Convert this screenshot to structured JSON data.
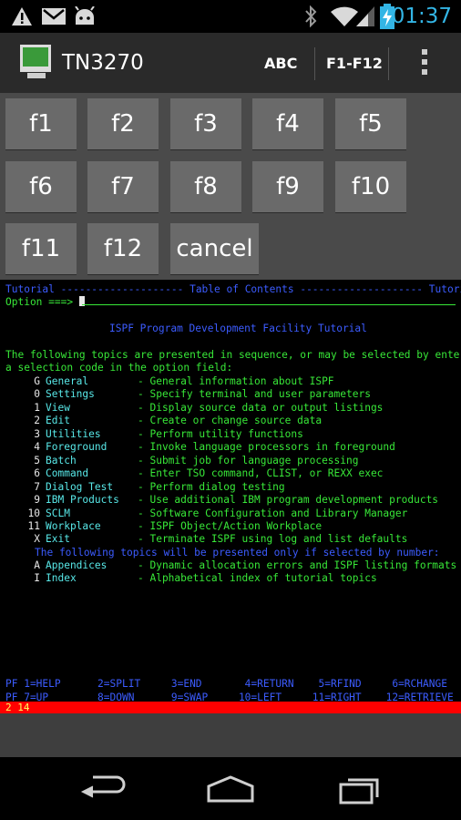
{
  "statusbar": {
    "time": "01:37"
  },
  "actionbar": {
    "title": "TN3270",
    "abc_label": "ABC",
    "fkeys_label": "F1-F12"
  },
  "keypad": {
    "keys": [
      "f1",
      "f2",
      "f3",
      "f4",
      "f5",
      "f6",
      "f7",
      "f8",
      "f9",
      "f10",
      "f11",
      "f12",
      "cancel"
    ]
  },
  "terminal": {
    "header_left": "Tutorial ",
    "header_dashes1": "--------------------",
    "header_title": " Table of Contents ",
    "header_dashes2": "--------------------",
    "header_right": " Tutorial",
    "option_label": "Option ===>",
    "heading": "ISPF Program Development Facility Tutorial",
    "intro1": "The following topics are presented in sequence, or may be selected by entering",
    "intro2": "a selection code in the option field:",
    "topics": [
      {
        "code": "G",
        "name": "General",
        "desc": "- General information about ISPF"
      },
      {
        "code": "0",
        "name": "Settings",
        "desc": "- Specify terminal and user parameters"
      },
      {
        "code": "1",
        "name": "View",
        "desc": "- Display source data or output listings"
      },
      {
        "code": "2",
        "name": "Edit",
        "desc": "- Create or change source data"
      },
      {
        "code": "3",
        "name": "Utilities",
        "desc": "- Perform utility functions"
      },
      {
        "code": "4",
        "name": "Foreground",
        "desc": "- Invoke language processors in foreground"
      },
      {
        "code": "5",
        "name": "Batch",
        "desc": "- Submit job for language processing"
      },
      {
        "code": "6",
        "name": "Command",
        "desc": "- Enter TSO command, CLIST, or REXX exec"
      },
      {
        "code": "7",
        "name": "Dialog Test",
        "desc": "- Perform dialog testing"
      },
      {
        "code": "9",
        "name": "IBM Products",
        "desc": "- Use additional IBM program development products"
      },
      {
        "code": "10",
        "name": "SCLM",
        "desc": "- Software Configuration and Library Manager"
      },
      {
        "code": "11",
        "name": "Workplace",
        "desc": "- ISPF Object/Action Workplace"
      },
      {
        "code": "X",
        "name": "Exit",
        "desc": "- Terminate ISPF using log and list defaults"
      }
    ],
    "note": "The following topics will be presented only if selected by number:",
    "extra_topics": [
      {
        "code": "A",
        "name": "Appendices",
        "desc": "- Dynamic allocation errors and ISPF listing formats"
      },
      {
        "code": "I",
        "name": "Index",
        "desc": "- Alphabetical index of tutorial topics"
      }
    ],
    "pf_line1": "PF 1=HELP      2=SPLIT     3=END       4=RETURN    5=RFIND     6=RCHANGE",
    "pf_line2": "PF 7=UP        8=DOWN      9=SWAP     10=LEFT     11=RIGHT    12=RETRIEVE",
    "status_line": "2 14"
  },
  "colors": {
    "terminal_blue": "#3c5cff",
    "terminal_green": "#38e838",
    "terminal_turquoise": "#58e8e8",
    "status_red": "#ff0000",
    "clock_blue": "#33b5e5"
  },
  "icons": {
    "status": [
      "warning-icon",
      "gmail-icon",
      "android-debug-icon",
      "bluetooth-icon",
      "wifi-icon",
      "signal-icon",
      "battery-charging-icon"
    ],
    "nav": [
      "back-icon",
      "home-icon",
      "recent-apps-icon"
    ]
  }
}
